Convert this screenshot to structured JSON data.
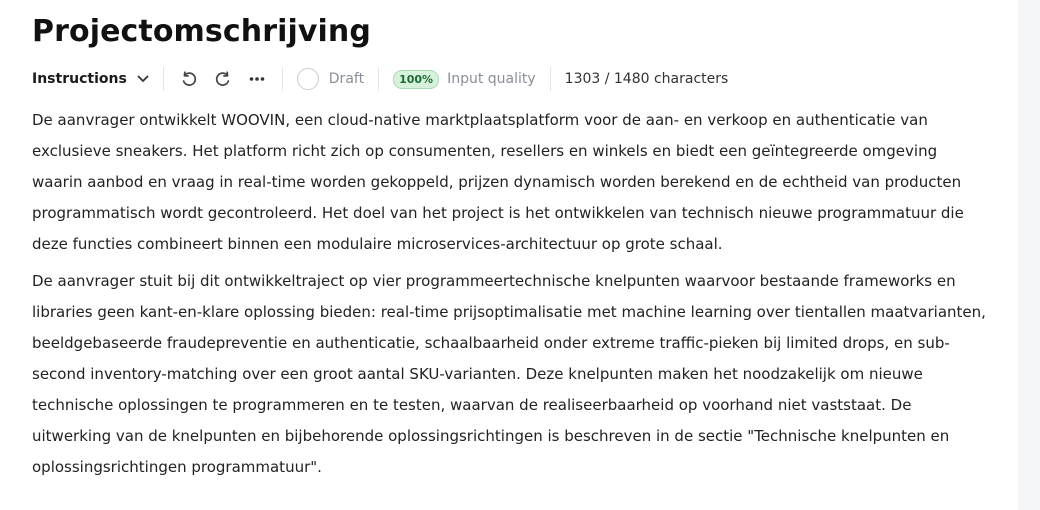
{
  "page": {
    "title": "Projectomschrijving"
  },
  "toolbar": {
    "instructions_label": "Instructions",
    "status_label": "Draft",
    "quality_badge": "100%",
    "quality_label": "Input quality",
    "character_count": "1303 / 1480 characters",
    "icons": [
      "chevron-down-icon",
      "undo-icon",
      "redo-icon",
      "more-icon"
    ]
  },
  "content": {
    "paragraphs": [
      "De aanvrager ontwikkelt WOOVIN, een cloud-native marktplaatsplatform voor de aan- en verkoop en authenticatie van exclusieve sneakers. Het platform richt zich op consumenten, resellers en winkels en biedt een geïntegreerde omgeving waarin aanbod en vraag in real-time worden gekoppeld, prijzen dynamisch worden berekend en de echtheid van producten programmatisch wordt gecontroleerd. Het doel van het project is het ontwikkelen van technisch nieuwe programmatuur die deze functies combineert binnen een modulaire microservices-architectuur op grote schaal.",
      "De aanvrager stuit bij dit ontwikkeltraject op vier programmeertechnische knelpunten waarvoor bestaande frameworks en libraries geen kant-en-klare oplossing bieden: real-time prijsoptimalisatie met machine learning over tientallen maatvarianten, beeldgebaseerde fraudepreventie en authenticatie, schaalbaarheid onder extreme traffic-pieken bij limited drops, en sub-second inventory-matching over een groot aantal SKU-varianten. Deze knelpunten maken het noodzakelijk om nieuwe technische oplossingen te programmeren en te testen, waarvan de realiseerbaarheid op voorhand niet vaststaat. De uitwerking van de knelpunten en bijbehorende oplossingsrichtingen is beschreven in de sectie \"Technische knelpunten en oplossingsrichtingen programmatuur\"."
    ]
  },
  "colors": {
    "badge_bg": "#d7f2dc",
    "badge_text": "#1d6b33",
    "muted_text": "#8a8f98"
  }
}
